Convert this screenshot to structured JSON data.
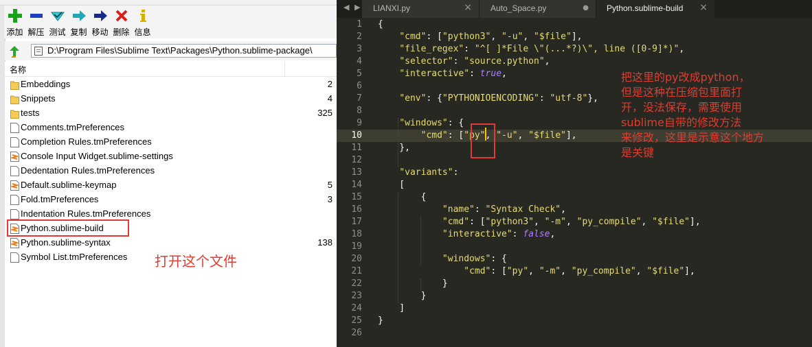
{
  "toolbar": {
    "buttons": [
      {
        "label": "添加",
        "icon": "add-icon"
      },
      {
        "label": "解压",
        "icon": "extract-icon"
      },
      {
        "label": "测试",
        "icon": "test-icon"
      },
      {
        "label": "复制",
        "icon": "copy-icon"
      },
      {
        "label": "移动",
        "icon": "move-icon"
      },
      {
        "label": "删除",
        "icon": "delete-icon"
      },
      {
        "label": "信息",
        "icon": "info-icon"
      }
    ]
  },
  "address": {
    "path": "D:\\Program Files\\Sublime Text\\Packages\\Python.sublime-package\\"
  },
  "filelist": {
    "col_name": "名称",
    "rows": [
      {
        "name": "Embeddings",
        "size": "2",
        "type": "folder"
      },
      {
        "name": "Snippets",
        "size": "4",
        "type": "folder"
      },
      {
        "name": "tests",
        "size": "325",
        "type": "folder"
      },
      {
        "name": "Comments.tmPreferences",
        "size": "",
        "type": "file"
      },
      {
        "name": "Completion Rules.tmPreferences",
        "size": "",
        "type": "file"
      },
      {
        "name": "Console Input Widget.sublime-settings",
        "size": "",
        "type": "sublime"
      },
      {
        "name": "Dedentation Rules.tmPreferences",
        "size": "",
        "type": "file"
      },
      {
        "name": "Default.sublime-keymap",
        "size": "5",
        "type": "sublime"
      },
      {
        "name": "Fold.tmPreferences",
        "size": "3",
        "type": "file"
      },
      {
        "name": "Indentation Rules.tmPreferences",
        "size": "",
        "type": "file"
      },
      {
        "name": "Python.sublime-build",
        "size": "",
        "type": "sublime"
      },
      {
        "name": "Python.sublime-syntax",
        "size": "138",
        "type": "sublime"
      },
      {
        "name": "Symbol List.tmPreferences",
        "size": "",
        "type": "file"
      }
    ]
  },
  "annotations": {
    "left_note": "打开这个文件",
    "right_note": [
      "把这里的py改成python，",
      "但是这种在压缩包里面打",
      "开，没法保存，需要使用",
      "sublime自带的修改方法",
      "来修改，这里是示意这个地方",
      "是关键"
    ]
  },
  "editor": {
    "tabs": [
      {
        "label": "LIANXI.py",
        "close": "×",
        "active": false
      },
      {
        "label": "Auto_Space.py",
        "close": "●",
        "active": false
      },
      {
        "label": "Python.sublime-build",
        "close": "×",
        "active": true
      }
    ],
    "current_line": 10,
    "lines": [
      [
        {
          "t": "{",
          "c": "p"
        }
      ],
      [
        {
          "t": "    ",
          "c": "p"
        },
        {
          "t": "\"cmd\"",
          "c": "str"
        },
        {
          "t": ": [",
          "c": "p"
        },
        {
          "t": "\"python3\"",
          "c": "str"
        },
        {
          "t": ", ",
          "c": "p"
        },
        {
          "t": "\"-u\"",
          "c": "str"
        },
        {
          "t": ", ",
          "c": "p"
        },
        {
          "t": "\"$file\"",
          "c": "str"
        },
        {
          "t": "],",
          "c": "p"
        }
      ],
      [
        {
          "t": "    ",
          "c": "p"
        },
        {
          "t": "\"file_regex\"",
          "c": "str"
        },
        {
          "t": ": ",
          "c": "p"
        },
        {
          "t": "\"^[ ]*File \\\"(...*?)\\\", line ([0-9]*)\"",
          "c": "str"
        },
        {
          "t": ",",
          "c": "p"
        }
      ],
      [
        {
          "t": "    ",
          "c": "p"
        },
        {
          "t": "\"selector\"",
          "c": "str"
        },
        {
          "t": ": ",
          "c": "p"
        },
        {
          "t": "\"source.python\"",
          "c": "str"
        },
        {
          "t": ",",
          "c": "p"
        }
      ],
      [
        {
          "t": "    ",
          "c": "p"
        },
        {
          "t": "\"interactive\"",
          "c": "str"
        },
        {
          "t": ": ",
          "c": "p"
        },
        {
          "t": "true",
          "c": "kc"
        },
        {
          "t": ",",
          "c": "p"
        }
      ],
      [],
      [
        {
          "t": "    ",
          "c": "p"
        },
        {
          "t": "\"env\"",
          "c": "str"
        },
        {
          "t": ": {",
          "c": "p"
        },
        {
          "t": "\"PYTHONIOENCODING\"",
          "c": "str"
        },
        {
          "t": ": ",
          "c": "p"
        },
        {
          "t": "\"utf-8\"",
          "c": "str"
        },
        {
          "t": "},",
          "c": "p"
        }
      ],
      [],
      [
        {
          "t": "    ",
          "c": "p"
        },
        {
          "t": "\"windows\"",
          "c": "str"
        },
        {
          "t": ": {",
          "c": "p"
        }
      ],
      [
        {
          "t": "        ",
          "c": "p"
        },
        {
          "t": "\"cmd\"",
          "c": "str"
        },
        {
          "t": ": [",
          "c": "p"
        },
        {
          "t": "\"py\"",
          "c": "str"
        },
        {
          "t": ", ",
          "c": "p"
        },
        {
          "t": "\"-u\"",
          "c": "str"
        },
        {
          "t": ", ",
          "c": "p"
        },
        {
          "t": "\"$file\"",
          "c": "str"
        },
        {
          "t": "],",
          "c": "p"
        }
      ],
      [
        {
          "t": "    },",
          "c": "p"
        }
      ],
      [],
      [
        {
          "t": "    ",
          "c": "p"
        },
        {
          "t": "\"variants\"",
          "c": "str"
        },
        {
          "t": ":",
          "c": "p"
        }
      ],
      [
        {
          "t": "    [",
          "c": "p"
        }
      ],
      [
        {
          "t": "        {",
          "c": "p"
        }
      ],
      [
        {
          "t": "            ",
          "c": "p"
        },
        {
          "t": "\"name\"",
          "c": "str"
        },
        {
          "t": ": ",
          "c": "p"
        },
        {
          "t": "\"Syntax Check\"",
          "c": "str"
        },
        {
          "t": ",",
          "c": "p"
        }
      ],
      [
        {
          "t": "            ",
          "c": "p"
        },
        {
          "t": "\"cmd\"",
          "c": "str"
        },
        {
          "t": ": [",
          "c": "p"
        },
        {
          "t": "\"python3\"",
          "c": "str"
        },
        {
          "t": ", ",
          "c": "p"
        },
        {
          "t": "\"-m\"",
          "c": "str"
        },
        {
          "t": ", ",
          "c": "p"
        },
        {
          "t": "\"py_compile\"",
          "c": "str"
        },
        {
          "t": ", ",
          "c": "p"
        },
        {
          "t": "\"$file\"",
          "c": "str"
        },
        {
          "t": "],",
          "c": "p"
        }
      ],
      [
        {
          "t": "            ",
          "c": "p"
        },
        {
          "t": "\"interactive\"",
          "c": "str"
        },
        {
          "t": ": ",
          "c": "p"
        },
        {
          "t": "false",
          "c": "kc"
        },
        {
          "t": ",",
          "c": "p"
        }
      ],
      [],
      [
        {
          "t": "            ",
          "c": "p"
        },
        {
          "t": "\"windows\"",
          "c": "str"
        },
        {
          "t": ": {",
          "c": "p"
        }
      ],
      [
        {
          "t": "                ",
          "c": "p"
        },
        {
          "t": "\"cmd\"",
          "c": "str"
        },
        {
          "t": ": [",
          "c": "p"
        },
        {
          "t": "\"py\"",
          "c": "str"
        },
        {
          "t": ", ",
          "c": "p"
        },
        {
          "t": "\"-m\"",
          "c": "str"
        },
        {
          "t": ", ",
          "c": "p"
        },
        {
          "t": "\"py_compile\"",
          "c": "str"
        },
        {
          "t": ", ",
          "c": "p"
        },
        {
          "t": "\"$file\"",
          "c": "str"
        },
        {
          "t": "],",
          "c": "p"
        }
      ],
      [
        {
          "t": "            }",
          "c": "p"
        }
      ],
      [
        {
          "t": "        }",
          "c": "p"
        }
      ],
      [
        {
          "t": "    ]",
          "c": "p"
        }
      ],
      [
        {
          "t": "}",
          "c": "p"
        }
      ],
      []
    ]
  }
}
